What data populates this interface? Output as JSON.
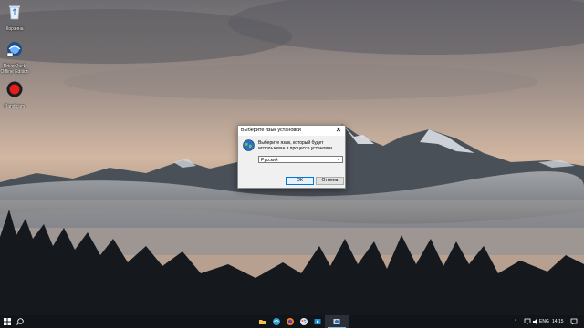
{
  "desktop": {
    "icons": [
      {
        "label": "Корзина",
        "icon": "recycle-bin-icon"
      },
      {
        "label": "DriverPack Offline Edition",
        "icon": "driverpack-icon"
      },
      {
        "label": "Bandicam",
        "icon": "bandicam-icon"
      }
    ]
  },
  "dialog": {
    "title": "Выберите язык установки",
    "close_glyph": "✕",
    "message": "Выберите язык, который будет использован в процессе установки.",
    "language_select": {
      "value": "Русский",
      "chevron": "⌄"
    },
    "ok_label": "ОК",
    "cancel_label": "Отмена"
  },
  "taskbar": {
    "language": "ENG",
    "time": "14:15",
    "pinned": [
      "file-explorer-icon",
      "edge-icon",
      "firefox-icon",
      "paint-icon",
      "media-icon",
      "installer-icon"
    ],
    "colors": {
      "background": "#111418",
      "active_underline": "#7fb2f0"
    }
  }
}
